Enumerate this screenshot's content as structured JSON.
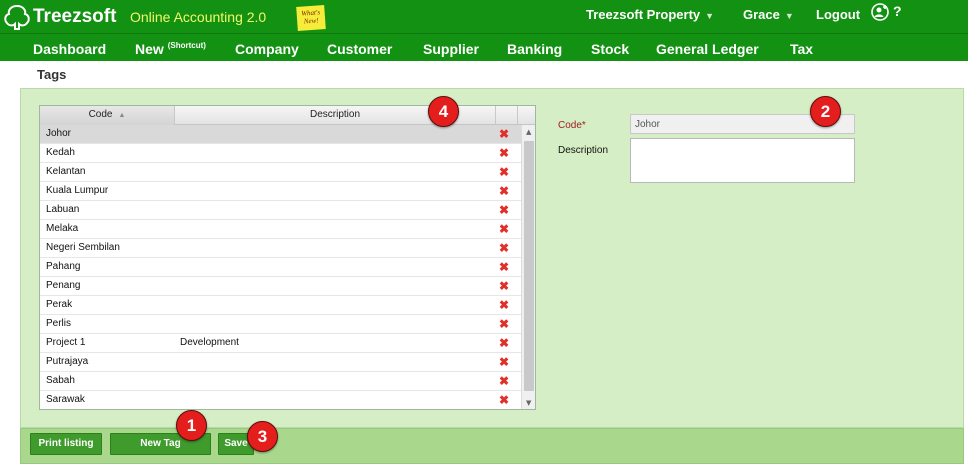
{
  "app": {
    "brand": "Treezsoft",
    "subtitle": "Online Accounting 2.0",
    "whats_new": "What's New!"
  },
  "topbar": {
    "company": "Treezsoft Property",
    "user": "Grace",
    "logout": "Logout",
    "help": "?"
  },
  "nav": {
    "items": [
      "Dashboard",
      "New",
      "Company",
      "Customer",
      "Supplier",
      "Banking",
      "Stock",
      "General Ledger",
      "Tax"
    ],
    "new_sup": "(Shortcut)"
  },
  "page": {
    "title": "Tags"
  },
  "grid": {
    "columns": {
      "code": "Code",
      "description": "Description"
    },
    "rows": [
      {
        "code": "Johor",
        "description": ""
      },
      {
        "code": "Kedah",
        "description": ""
      },
      {
        "code": "Kelantan",
        "description": ""
      },
      {
        "code": "Kuala Lumpur",
        "description": ""
      },
      {
        "code": "Labuan",
        "description": ""
      },
      {
        "code": "Melaka",
        "description": ""
      },
      {
        "code": "Negeri Sembilan",
        "description": ""
      },
      {
        "code": "Pahang",
        "description": ""
      },
      {
        "code": "Penang",
        "description": ""
      },
      {
        "code": "Perak",
        "description": ""
      },
      {
        "code": "Perlis",
        "description": ""
      },
      {
        "code": "Project 1",
        "description": "Development"
      },
      {
        "code": "Putrajaya",
        "description": ""
      },
      {
        "code": "Sabah",
        "description": ""
      },
      {
        "code": "Sarawak",
        "description": ""
      }
    ],
    "delete_glyph": "✖"
  },
  "form": {
    "code_label": "Code*",
    "code_value": "Johor",
    "description_label": "Description",
    "description_value": ""
  },
  "buttons": {
    "print": "Print listing",
    "new_tag": "New Tag",
    "save": "Save"
  },
  "badges": [
    "1",
    "2",
    "3",
    "4"
  ],
  "colors": {
    "brand_green": "#129112",
    "panel_bg": "#d5eec5",
    "button_green": "#3f9b2c",
    "badge_red": "#e41d1d",
    "required_label": "#a02020"
  }
}
